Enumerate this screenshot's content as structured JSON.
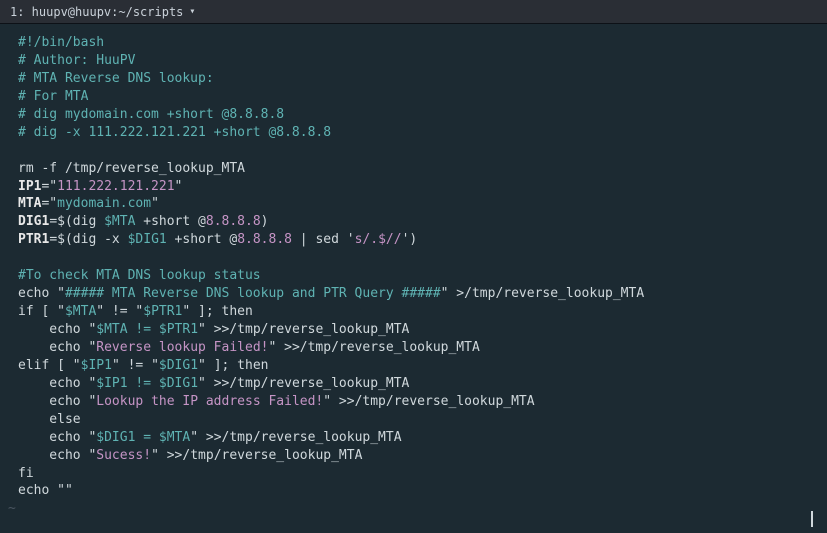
{
  "titlebar": {
    "label": "1: huupv@huupv:~/scripts",
    "dropdown_glyph": "▾"
  },
  "code": {
    "l1_shebang": "#!/bin/bash",
    "l2_author": "# Author: HuuPV",
    "l3_mta_rev": "# MTA Reverse DNS lookup:",
    "l4_for_mta": "# For MTA",
    "l5_dig1": "# dig mydomain.com +short @8.8.8.8",
    "l6_dig2": "# dig -x 111.222.121.221 +short @8.8.8.8",
    "l8_rm": "rm -f /tmp/reverse_lookup_MTA",
    "l9_ip_var": "IP1",
    "l9_eq": "=\"",
    "l9_ip_val": "111.222.121.221",
    "l9_close": "\"",
    "l10_mta_var": "MTA",
    "l10_mta_val": "mydomain.com",
    "l11_dig_var": "DIG1",
    "l11_open": "=$(",
    "l11_dig": "dig ",
    "l11_mta_ref": "$MTA",
    "l11_short": " +short @",
    "l11_dns": "8.8.8.8",
    "l11_close": ")",
    "l12_ptr_var": "PTR1",
    "l12_dig": "dig -x ",
    "l12_dig1_ref": "$DIG1",
    "l12_short": " +short @",
    "l12_dns": "8.8.8.8",
    "l12_pipe": " | sed '",
    "l12_sed": "s/.$//",
    "l12_end": "')",
    "l14_comment": "#To check MTA DNS lookup status",
    "l15_echo": "echo \"",
    "l15_msg": "##### MTA Reverse DNS lookup and PTR Query #####",
    "l15_end": "\" >/tmp/reverse_lookup_MTA",
    "l16_if": "if [ \"",
    "l16_mta": "$MTA",
    "l16_ne": "\" != \"",
    "l16_ptr": "$PTR1",
    "l16_then": "\" ]; then",
    "l17_echo": "    echo \"",
    "l17_mta": "$MTA",
    "l17_ne": " != ",
    "l17_ptr": "$PTR1",
    "l17_end": "\" >>/tmp/reverse_lookup_MTA",
    "l18_echo": "    echo \"",
    "l18_msg": "Reverse lookup Failed!",
    "l18_end": "\" >>/tmp/reverse_lookup_MTA",
    "l19_elif": "elif [ \"",
    "l19_ip": "$IP1",
    "l19_ne": "\" != \"",
    "l19_dig": "$DIG1",
    "l19_then": "\" ]; then",
    "l20_echo": "    echo \"",
    "l20_ip": "$IP1",
    "l20_ne": " != ",
    "l20_dig": "$DIG1",
    "l20_end": "\" >>/tmp/reverse_lookup_MTA",
    "l21_echo": "    echo \"",
    "l21_msg": "Lookup the IP address Failed!",
    "l21_end": "\" >>/tmp/reverse_lookup_MTA",
    "l22_else": "    else",
    "l23_echo": "    echo \"",
    "l23_dig": "$DIG1",
    "l23_eq": " = ",
    "l23_mta": "$MTA",
    "l23_end": "\" >>/tmp/reverse_lookup_MTA",
    "l24_echo": "    echo \"",
    "l24_msg": "Sucess!",
    "l24_end": "\" >>/tmp/reverse_lookup_MTA",
    "l25_fi": "fi",
    "l26_echo": "echo \"\"",
    "tilde": "~"
  }
}
